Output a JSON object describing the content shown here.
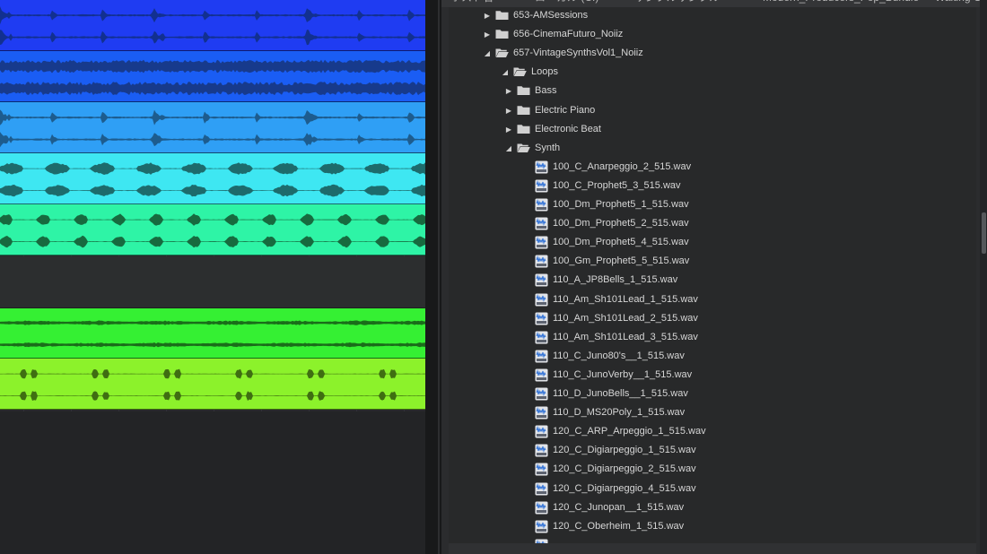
{
  "browser": {
    "breadcrumb": [
      {
        "text": "ホスト名"
      },
      {
        "text": "ローカル (C:)"
      },
      {
        "text": "サンプルサンプル"
      },
      {
        "text": "Modern_Producers_Pop_Bundle"
      },
      {
        "text": "Waiting On A (Guitar Sample Pack)"
      }
    ],
    "tree": [
      {
        "label": "653-AMSessions",
        "kind": "folder",
        "depth": 0,
        "expanded": false
      },
      {
        "label": "656-CinemaFuturo_Noiiz",
        "kind": "folder",
        "depth": 0,
        "expanded": false
      },
      {
        "label": "657-VintageSynthsVol1_Noiiz",
        "kind": "folder-open",
        "depth": 0,
        "expanded": true
      },
      {
        "label": "Loops",
        "kind": "folder-open",
        "depth": 1,
        "expanded": true
      },
      {
        "label": "Bass",
        "kind": "folder",
        "depth": 2,
        "expanded": false
      },
      {
        "label": "Electric Piano",
        "kind": "folder",
        "depth": 2,
        "expanded": false
      },
      {
        "label": "Electronic Beat",
        "kind": "folder",
        "depth": 2,
        "expanded": false
      },
      {
        "label": "Synth",
        "kind": "folder-open",
        "depth": 2,
        "expanded": true
      },
      {
        "label": "100_C_Anarpeggio_2_515.wav",
        "kind": "wav",
        "depth": 3
      },
      {
        "label": "100_C_Prophet5_3_515.wav",
        "kind": "wav",
        "depth": 3
      },
      {
        "label": "100_Dm_Prophet5_1_515.wav",
        "kind": "wav",
        "depth": 3
      },
      {
        "label": "100_Dm_Prophet5_2_515.wav",
        "kind": "wav",
        "depth": 3
      },
      {
        "label": "100_Dm_Prophet5_4_515.wav",
        "kind": "wav",
        "depth": 3
      },
      {
        "label": "100_Gm_Prophet5_5_515.wav",
        "kind": "wav",
        "depth": 3
      },
      {
        "label": "110_A_JP8Bells_1_515.wav",
        "kind": "wav",
        "depth": 3
      },
      {
        "label": "110_Am_Sh101Lead_1_515.wav",
        "kind": "wav",
        "depth": 3
      },
      {
        "label": "110_Am_Sh101Lead_2_515.wav",
        "kind": "wav",
        "depth": 3
      },
      {
        "label": "110_Am_Sh101Lead_3_515.wav",
        "kind": "wav",
        "depth": 3
      },
      {
        "label": "110_C_Juno80's__1_515.wav",
        "kind": "wav",
        "depth": 3
      },
      {
        "label": "110_C_JunoVerby__1_515.wav",
        "kind": "wav",
        "depth": 3
      },
      {
        "label": "110_D_JunoBells__1_515.wav",
        "kind": "wav",
        "depth": 3
      },
      {
        "label": "110_D_MS20Poly_1_515.wav",
        "kind": "wav",
        "depth": 3
      },
      {
        "label": "120_C_ARP_Arpeggio_1_515.wav",
        "kind": "wav",
        "depth": 3
      },
      {
        "label": "120_C_Digiarpeggio_1_515.wav",
        "kind": "wav",
        "depth": 3
      },
      {
        "label": "120_C_Digiarpeggio_2_515.wav",
        "kind": "wav",
        "depth": 3
      },
      {
        "label": "120_C_Digiarpeggio_4_515.wav",
        "kind": "wav",
        "depth": 3
      },
      {
        "label": "120_C_Junopan__1_515.wav",
        "kind": "wav",
        "depth": 3
      },
      {
        "label": "120_C_Oberheim_1_515.wav",
        "kind": "wav",
        "depth": 3
      },
      {
        "label": "",
        "kind": "wav",
        "depth": 3
      }
    ]
  },
  "arrangement": {
    "tracks": [
      {
        "color": "#1f3cf2",
        "wave": "#123090",
        "pattern": "sparse"
      },
      {
        "color": "#1a5df4",
        "wave": "#173a8c",
        "pattern": "dense"
      },
      {
        "color": "#2f9ff5",
        "wave": "#1d5c8e",
        "pattern": "sparse"
      },
      {
        "color": "#3ee7f2",
        "wave": "#1d6b6c",
        "pattern": "blobs"
      },
      {
        "color": "#2ef4a6",
        "wave": "#176a3f",
        "pattern": "blobs2"
      },
      {
        "color": "#35f033",
        "wave": "#1a6d1a",
        "pattern": "pad"
      },
      {
        "color": "#8cf22b",
        "wave": "#3f6e12",
        "pattern": "hits"
      }
    ]
  },
  "icons": {
    "folder": "folder-icon",
    "folder_open": "folder-open-icon",
    "wav": "wav-file-icon",
    "expand": "triangle-right-icon",
    "collapse": "triangle-down-icon"
  }
}
